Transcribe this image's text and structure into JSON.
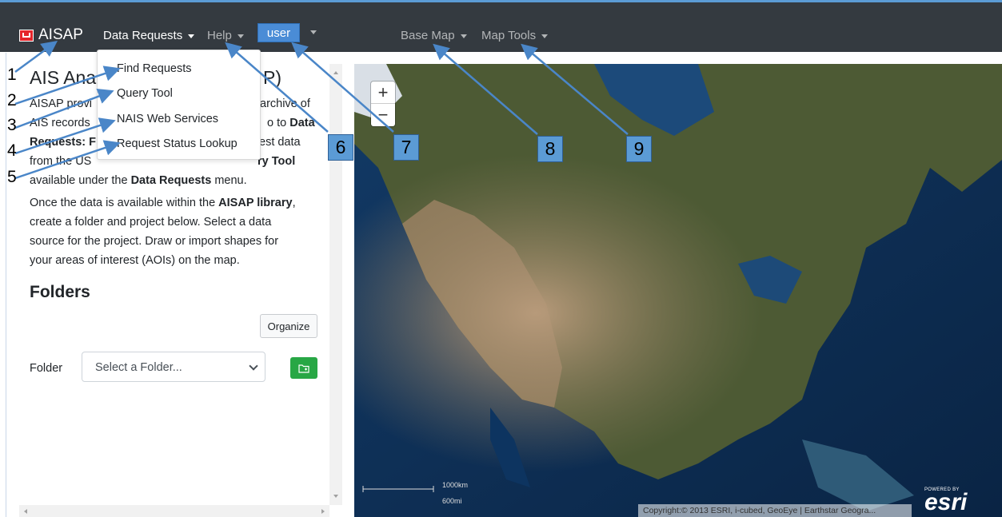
{
  "navbar": {
    "brand": "AISAP",
    "data_requests": "Data Requests",
    "help": "Help",
    "user": "user",
    "base_map": "Base Map",
    "map_tools": "Map Tools"
  },
  "dropdown": {
    "items": [
      "Find Requests",
      "Query Tool",
      "NAIS Web Services",
      "Request Status Lookup"
    ]
  },
  "sidebar": {
    "title_left": "AIS Ana",
    "title_right": "P)",
    "intro_lines": [
      {
        "a": "AISAP provi",
        "b": "archive of"
      },
      {
        "a": "AIS records",
        "b": "o to ",
        "bold": "Data"
      },
      {
        "bold1": "Requests: F",
        "b": "est data"
      },
      {
        "a": "from the US",
        "bold2": "ry Tool"
      },
      {
        "a": "available under the ",
        "bold": "Data Requests",
        "c": " menu."
      }
    ],
    "para2_lines": [
      {
        "a": "Once the data is available within the ",
        "bold": "AISAP library",
        "c": ","
      },
      {
        "a": "create a folder and project below. Select a data"
      },
      {
        "a": "source for the project. Draw or import shapes for"
      },
      {
        "a": "your areas of interest (AOIs) on the map."
      }
    ],
    "folders_heading": "Folders",
    "organize_label": "Organize",
    "folder_label": "Folder",
    "folder_select_placeholder": "Select a Folder..."
  },
  "map": {
    "zoom_in": "+",
    "zoom_out": "−",
    "scale_km": "1000km",
    "scale_mi": "600mi",
    "copyright": "Copyright:© 2013 ESRI, i-cubed, GeoEye | Earthstar Geogra...",
    "powered_by": "POWERED BY",
    "esri_logo": "esri"
  },
  "callouts": [
    "1",
    "2",
    "3",
    "4",
    "5",
    "6",
    "7",
    "8",
    "9"
  ],
  "colors": {
    "navbar_bg": "#343a40",
    "callout_fill": "#5b9bd5",
    "add_button": "#28a745"
  }
}
